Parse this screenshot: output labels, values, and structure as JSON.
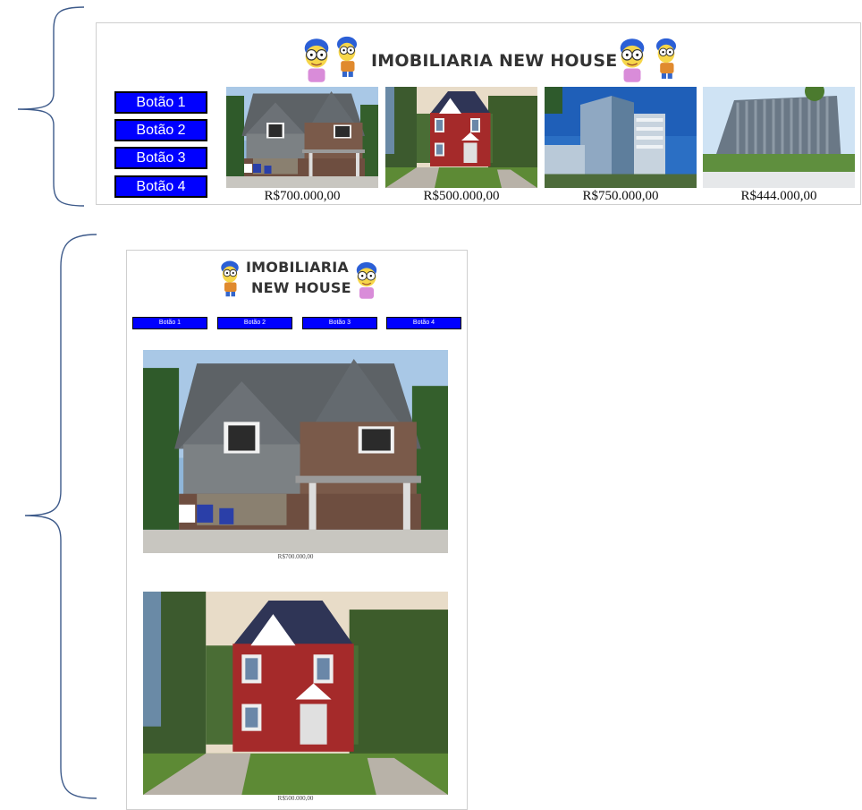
{
  "desktop": {
    "title": "IMOBILIARIA NEW HOUSE",
    "buttons": [
      "Botão 1",
      "Botão 2",
      "Botão 3",
      "Botão 4"
    ],
    "listings": [
      {
        "price": "R$700.000,00",
        "image": "gray-brick-house"
      },
      {
        "price": "R$500.000,00",
        "image": "red-house"
      },
      {
        "price": "R$750.000,00",
        "image": "glass-office-tower"
      },
      {
        "price": "R$444.000,00",
        "image": "curved-office-building"
      }
    ]
  },
  "mobile": {
    "title_line1": "IMOBILIARIA",
    "title_line2": "NEW HOUSE",
    "buttons": [
      "Botão 1",
      "Botão 2",
      "Botão 3",
      "Botão 4"
    ],
    "listings": [
      {
        "price": "R$700.000,00",
        "image": "gray-brick-house"
      },
      {
        "price": "R$500.000,00",
        "image": "red-house"
      }
    ]
  },
  "colors": {
    "button_bg": "#0000ff",
    "button_text": "#ffffff",
    "brace": "#3d5a8a"
  }
}
